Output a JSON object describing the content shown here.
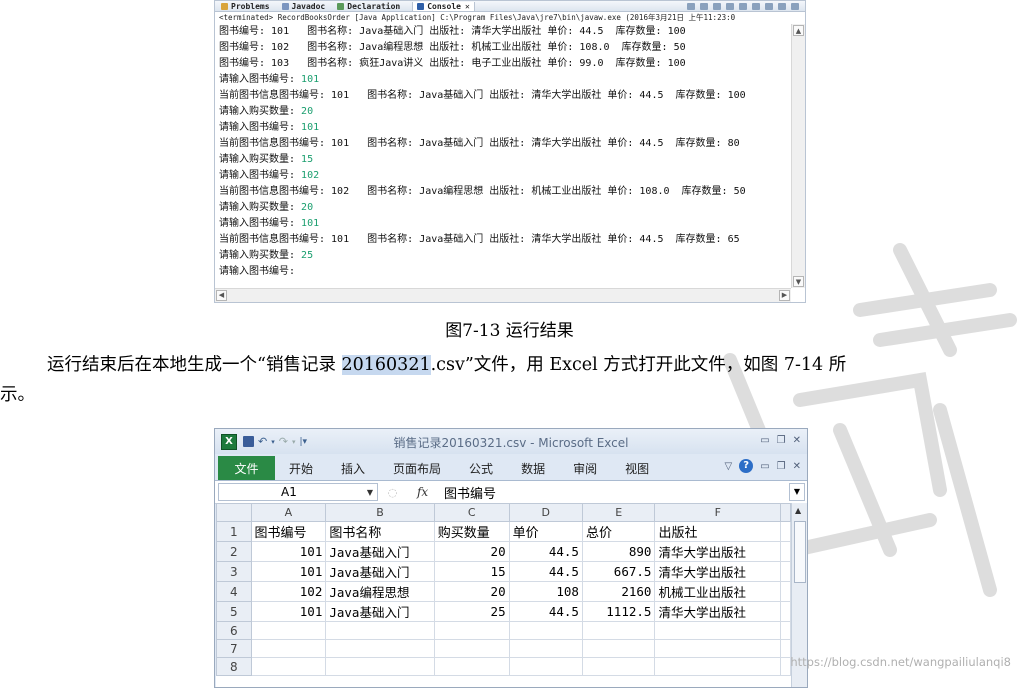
{
  "eclipse": {
    "tabs": [
      "Problems",
      "Javadoc",
      "Declaration",
      "Console"
    ],
    "status": "<terminated> RecordBooksOrder [Java Application] C:\\Program Files\\Java\\jre7\\bin\\javaw.exe (2016年3月21日 上午11:23:0",
    "lines": [
      {
        "text": "图书编号: 101   图书名称: Java基础入门 出版社: 清华大学出版社 单价: 44.5  库存数量: 100",
        "input": ""
      },
      {
        "text": "图书编号: 102   图书名称: Java编程思想 出版社: 机械工业出版社 单价: 108.0  库存数量: 50",
        "input": ""
      },
      {
        "text": "图书编号: 103   图书名称: 疯狂Java讲义 出版社: 电子工业出版社 单价: 99.0  库存数量: 100",
        "input": ""
      },
      {
        "text": "请输入图书编号: ",
        "input": "101"
      },
      {
        "text": "当前图书信息图书编号: 101   图书名称: Java基础入门 出版社: 清华大学出版社 单价: 44.5  库存数量: 100",
        "input": ""
      },
      {
        "text": "请输入购买数量: ",
        "input": "20"
      },
      {
        "text": "请输入图书编号: ",
        "input": "101"
      },
      {
        "text": "当前图书信息图书编号: 101   图书名称: Java基础入门 出版社: 清华大学出版社 单价: 44.5  库存数量: 80",
        "input": ""
      },
      {
        "text": "请输入购买数量: ",
        "input": "15"
      },
      {
        "text": "请输入图书编号: ",
        "input": "102"
      },
      {
        "text": "当前图书信息图书编号: 102   图书名称: Java编程思想 出版社: 机械工业出版社 单价: 108.0  库存数量: 50",
        "input": ""
      },
      {
        "text": "请输入购买数量: ",
        "input": "20"
      },
      {
        "text": "请输入图书编号: ",
        "input": "101"
      },
      {
        "text": "当前图书信息图书编号: 101   图书名称: Java基础入门 出版社: 清华大学出版社 单价: 44.5  库存数量: 65",
        "input": ""
      },
      {
        "text": "请输入购买数量: ",
        "input": "25"
      },
      {
        "text": "请输入图书编号: ",
        "input": ""
      }
    ]
  },
  "caption": "图7-13  运行结果",
  "paragraph": {
    "before": "运行结束后在本地生成一个“销售记录 ",
    "highlight": "20160321",
    "after": ".csv”文件，用 Excel 方式打开此文件，如图 7-14 所",
    "line2": "示。"
  },
  "excel": {
    "title": "销售记录20160321.csv - Microsoft Excel",
    "file_tab": "文件",
    "tabs": [
      "开始",
      "插入",
      "页面布局",
      "公式",
      "数据",
      "审阅",
      "视图"
    ],
    "name_box": "A1",
    "fx": "fx",
    "formula": "图书编号",
    "columns": [
      "A",
      "B",
      "C",
      "D",
      "E",
      "F"
    ],
    "header_row": [
      "图书编号",
      "图书名称",
      "购买数量",
      "单价",
      "总价",
      "出版社"
    ],
    "rows": [
      [
        "101",
        "Java基础入门",
        "20",
        "44.5",
        "890",
        "清华大学出版社"
      ],
      [
        "101",
        "Java基础入门",
        "15",
        "44.5",
        "667.5",
        "清华大学出版社"
      ],
      [
        "102",
        "Java编程思想",
        "20",
        "108",
        "2160",
        "机械工业出版社"
      ],
      [
        "101",
        "Java基础入门",
        "25",
        "44.5",
        "1112.5",
        "清华大学出版社"
      ]
    ],
    "row_numbers": [
      "1",
      "2",
      "3",
      "4",
      "5",
      "6",
      "7",
      "8"
    ]
  },
  "credit": "https://blog.csdn.net/wangpailiulanqi8"
}
